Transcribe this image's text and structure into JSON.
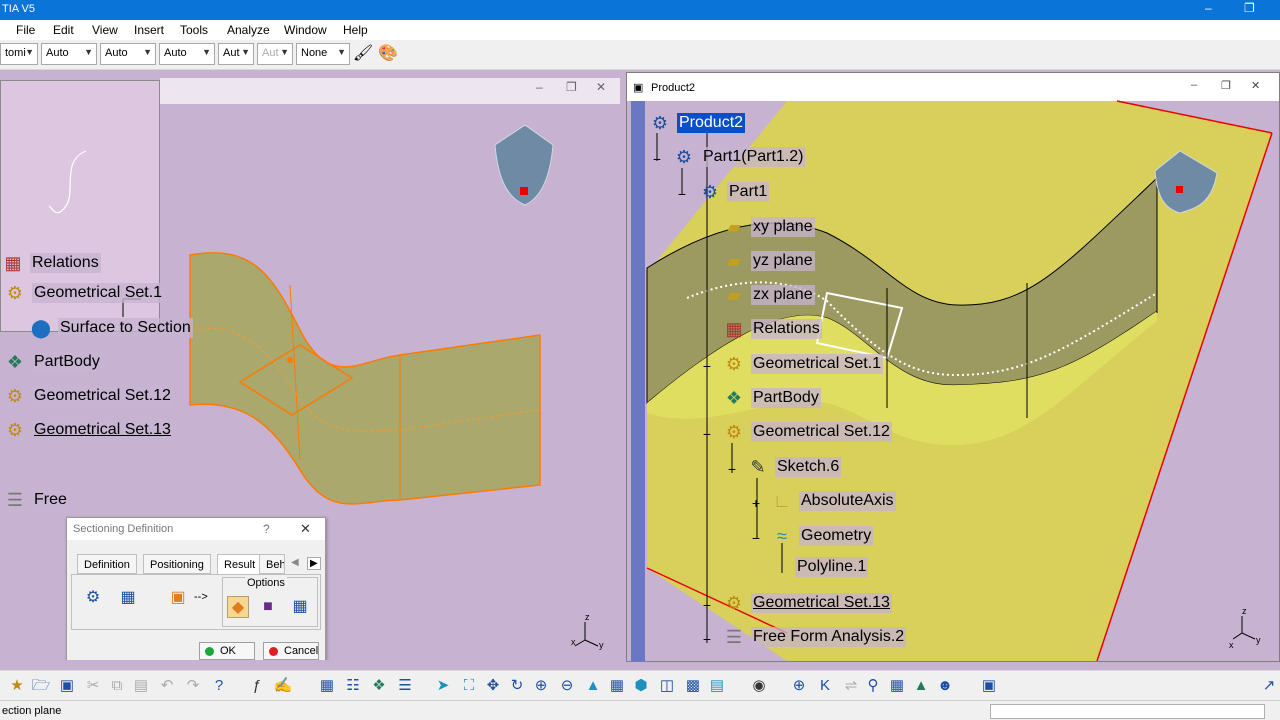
{
  "titlebar": {
    "title": "TIA V5"
  },
  "menu": [
    "File",
    "Edit",
    "View",
    "Insert",
    "Tools",
    "Analyze",
    "Window",
    "Help"
  ],
  "toolbar": {
    "combos": [
      {
        "value": "tomi"
      },
      {
        "value": "Auto"
      },
      {
        "value": "Auto"
      },
      {
        "value": "Auto"
      },
      {
        "value": "Aut"
      },
      {
        "value": "Aut"
      },
      {
        "value": "None"
      }
    ]
  },
  "right_window": {
    "title": "Product2"
  },
  "left_tree": [
    {
      "label": "Relations"
    },
    {
      "label": "Geometrical Set.1"
    },
    {
      "label": "Surface to Section"
    },
    {
      "label": "PartBody"
    },
    {
      "label": "Geometrical Set.12"
    },
    {
      "label": "Geometrical Set.13"
    },
    {
      "label": "Free"
    }
  ],
  "right_tree": [
    {
      "label": "Product2"
    },
    {
      "label": "Part1(Part1.2)"
    },
    {
      "label": "Part1"
    },
    {
      "label": "xy plane"
    },
    {
      "label": "yz plane"
    },
    {
      "label": "zx plane"
    },
    {
      "label": "Relations"
    },
    {
      "label": "Geometrical Set.1"
    },
    {
      "label": "PartBody"
    },
    {
      "label": "Geometrical Set.12"
    },
    {
      "label": "Sketch.6"
    },
    {
      "label": "AbsoluteAxis"
    },
    {
      "label": "Geometry"
    },
    {
      "label": "Polyline.1"
    },
    {
      "label": "Geometrical Set.13"
    },
    {
      "label": "Free Form Analysis.2"
    }
  ],
  "dialog": {
    "title": "Sectioning Definition",
    "help": "?",
    "tabs": [
      "Definition",
      "Positioning",
      "Result",
      "Beh"
    ],
    "options_label": "Options",
    "arrow": "-->",
    "ok": "OK",
    "cancel": "Cancel"
  },
  "axis": {
    "x": "x",
    "y": "y",
    "z": "z"
  },
  "status": {
    "text": "ection plane"
  },
  "colors": {
    "accent": "#0a74d8",
    "background": "#c7b3d1",
    "plane": "#d8d05a",
    "surface": "#b0b06a",
    "edge": "#ff7a00",
    "selection": "#0a4ec8"
  }
}
